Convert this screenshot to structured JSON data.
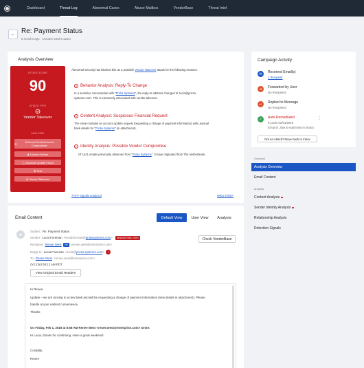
{
  "nav": {
    "items": [
      "Dashboard",
      "Threat Log",
      "Abnormal Cases",
      "Abuse Mailbox",
      "VendorBase",
      "Threat Intel"
    ]
  },
  "header": {
    "title": "Re: Payment Status",
    "subtitle": "5 months ago · October 23rd 9:12am"
  },
  "analysis": {
    "title": "Analysis Overview",
    "attack_score_label": "ATTACK SCORE",
    "score": "90",
    "attack_type_label": "ATTACK TYPE",
    "attack_type": "Vendor Takeover",
    "analyzed_label": "ANALYZED",
    "analyzed_items": [
      "External Email Account Compromise",
      "Known Partner",
      "Account Update Fraud",
      "Text",
      "Vendor Takeover"
    ],
    "intro_pre": "Abnormal Security has blocked this as a possible ",
    "intro_link": "Vendor Takeover",
    "intro_post": " attack for the following reasons:",
    "sections": [
      {
        "title": "Behavior Analysis: Reply-To Change",
        "l1_pre": "In a sensitive conversation with \"",
        "l1_link": "Prolia Systems",
        "l1_post": "\", the reply-to address changed to 'lucia@pro1a-",
        "l2": "systems.com'. This is commonly associated with vendor takeover."
      },
      {
        "title": "Content Analysis: Suspicious Financial Request",
        "l1": "The email contains an account update request (requesting a change of payment information) with unusual",
        "l2_pre": "bank details for \"",
        "l2_link": "Prolia Systems",
        "l2_post": "\" (in attachment)."
      },
      {
        "title": "Identity Analysis: Possible Vendor Compromise",
        "l1_pre": "Of 1341 emails previously observed from \"",
        "l1_link": "Prolia Systems",
        "l1_post": "\", 0 have originated from The Netherlands."
      }
    ],
    "signals_link": "7707+ signals analyzed",
    "what_link": "What is this?"
  },
  "campaign": {
    "title": "Campaign Activity",
    "items": [
      {
        "title": "Received Email(s)",
        "sub": "1 Recipient"
      },
      {
        "title": "Forwarded by User",
        "sub": "No Recipients"
      },
      {
        "title": "Replied to Message",
        "sub": "No Recipients"
      },
      {
        "title": "Auto-Remediated",
        "sub": "9:12am 02/01/2019",
        "sub2": "Email in Junk E-mail (was in inbox)"
      }
    ],
    "not_attack_button": "Not an Attack? Move back to Inbox"
  },
  "sidebar": {
    "overview_label": "Overview",
    "overview_items": [
      "Analysis Overview",
      "Email Content"
    ],
    "analysis_label": "Analysis",
    "analysis_items": [
      "Content Analysis",
      "Sender Identity Analysis",
      "Relationship Analysis",
      "Detection Signals"
    ]
  },
  "email": {
    "title": "Email Content",
    "tabs": [
      "Default View",
      "User View",
      "Analysis"
    ],
    "subject_label": "Subject:",
    "subject": "Re: Payment Status",
    "sender_label": "Sender:",
    "sender_name": "Lucia Foreman",
    "sender_pre": "<luciaforeman@",
    "sender_domain": "proliasystems.com",
    "sender_post": ">",
    "vendor_risk": "VENDOR RISK: HIGH",
    "check_button": "Check VendorBase",
    "recipient_label": "Recipient:",
    "recipient_name": "Renee West",
    "vip": "VIP",
    "recipient_email": "<renee.west@enterprise.com>",
    "replyto_label": "Reply-to:",
    "replyto_name": "Lucia Foreman",
    "replyto_pre": "<lucia@",
    "replyto_domain": "pro1a-systems.com",
    "replyto_post": ">",
    "replyto_alert": "!",
    "to_label": "To:",
    "to_name": "Renee West",
    "to_email": "<renee.west@enterprise.com>",
    "date": "Oct 23rd 09:12 AM PDT",
    "headers_button": "View Original Email Headers",
    "body": [
      "Hi Renee,",
      "Update – we are moving to a new bank and will be requesting a change of payment information (new details in attachment). Please",
      "handle at your earliest convenience.",
      "Thanks",
      "On Friday, Feb 1, 2019 at 8:58 AM Renee West <renee.west@enterprise.com> wrote:",
      "Hi Lucia, thanks for confirming. Have a great weekend!",
      "Cordially,",
      "Renee"
    ]
  },
  "colors": {
    "red": "#c6191f",
    "blue": "#1a57c5",
    "nav": "#1f2a36"
  }
}
